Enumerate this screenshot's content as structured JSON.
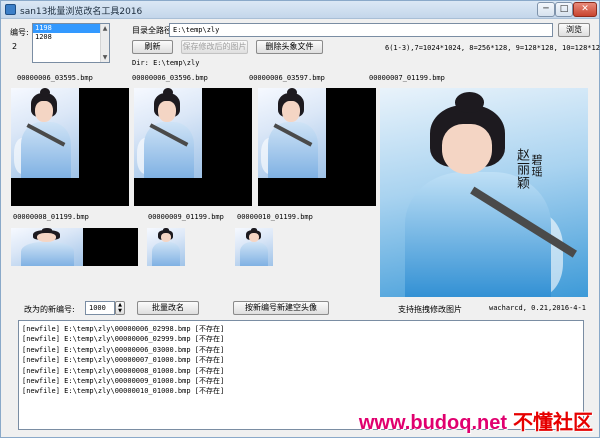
{
  "window": {
    "title": "san13批量浏览改名工具2016",
    "min_glyph": "─",
    "max_glyph": "□",
    "close_glyph": "✕"
  },
  "left_panel": {
    "id_label": "编号:",
    "count": "2",
    "list_items": [
      "1198",
      "1208"
    ],
    "selected_index": 0
  },
  "path": {
    "label": "目录全路径",
    "value": "E:\\temp\\zly",
    "browse_button": "浏览",
    "dir_text": "Dir: E:\\temp\\zly"
  },
  "toolbar": {
    "refresh": "刷新",
    "save_modified": "保存修改后的图片",
    "delete_headshot": "删除头象文件"
  },
  "size_info": "6(1-3),7=1024*1024, 8=256*128, 9=128*128, 10=128*128",
  "thumbnails": [
    {
      "filename": "00000006_03595.bmp"
    },
    {
      "filename": "00000006_03596.bmp"
    },
    {
      "filename": "00000006_03597.bmp"
    },
    {
      "filename": "00000007_01199.bmp"
    },
    {
      "filename": "00000008_01199.bmp"
    },
    {
      "filename": "00000009_01199.bmp"
    },
    {
      "filename": "00000010_01199.bmp"
    }
  ],
  "preview": {
    "calligraphy_left": "赵丽颖",
    "calligraphy_right": "碧瑶"
  },
  "rename": {
    "label": "改为的新编号:",
    "value": "1000",
    "batch_button": "批量改名",
    "new_headshot_button": "按新编号新建空头像"
  },
  "drag_hint": "支持拖拽修改图片",
  "credit": "wacharcd, 0.21,2016-4-1",
  "log_lines": [
    "[newfile] E:\\temp\\zly\\00000006_02998.bmp [不存在]",
    "[newfile] E:\\temp\\zly\\00000006_02999.bmp [不存在]",
    "[newfile] E:\\temp\\zly\\00000006_03000.bmp [不存在]",
    "[newfile] E:\\temp\\zly\\00000007_01000.bmp [不存在]",
    "[newfile] E:\\temp\\zly\\00000008_01000.bmp [不存在]",
    "[newfile] E:\\temp\\zly\\00000009_01000.bmp [不存在]",
    "[newfile] E:\\temp\\zly\\00000010_01000.bmp [不存在]"
  ],
  "watermark": {
    "url": "www.budoq.net",
    "cn": "不懂社区"
  },
  "colors": {
    "selection": "#3399ff",
    "watermark_pink": "#e0006f",
    "watermark_red": "#e60000"
  }
}
